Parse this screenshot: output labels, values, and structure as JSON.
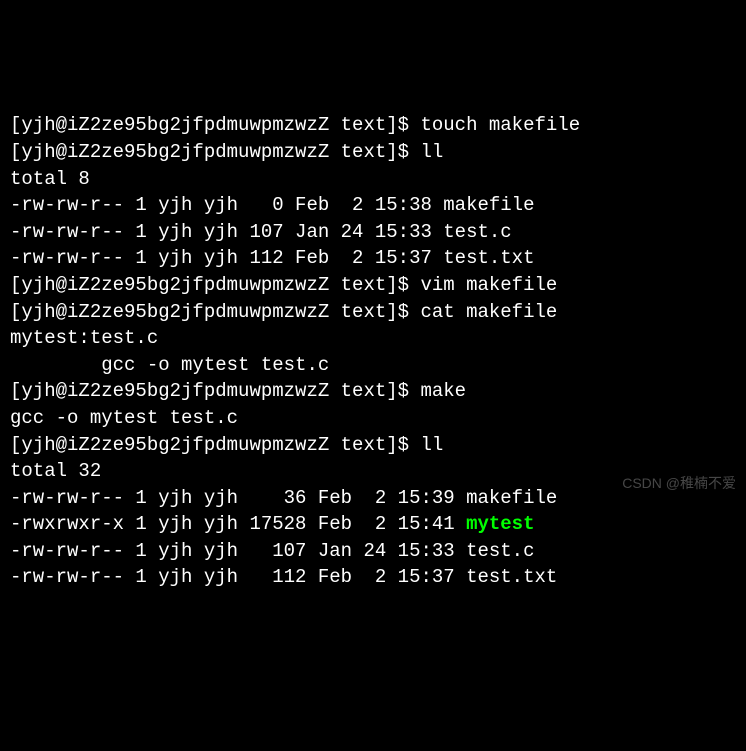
{
  "prompt": "[yjh@iZ2ze95bg2jfpdmuwpmzwzZ text]$ ",
  "lines": [
    {
      "prompt": true,
      "cmd": "touch makefile"
    },
    {
      "prompt": true,
      "cmd": "ll"
    },
    {
      "text": "total 8"
    },
    {
      "text": "-rw-rw-r-- 1 yjh yjh   0 Feb  2 15:38 makefile"
    },
    {
      "text": "-rw-rw-r-- 1 yjh yjh 107 Jan 24 15:33 test.c"
    },
    {
      "text": "-rw-rw-r-- 1 yjh yjh 112 Feb  2 15:37 test.txt"
    },
    {
      "prompt": true,
      "cmd": "vim makefile"
    },
    {
      "prompt": true,
      "cmd": "cat makefile"
    },
    {
      "text": "mytest:test.c"
    },
    {
      "text": "        gcc -o mytest test.c"
    },
    {
      "prompt": true,
      "cmd": "make"
    },
    {
      "text": "gcc -o mytest test.c"
    },
    {
      "prompt": true,
      "cmd": "ll"
    },
    {
      "text": "total 32"
    },
    {
      "text": "-rw-rw-r-- 1 yjh yjh    36 Feb  2 15:39 makefile"
    },
    {
      "text": "-rwxrwxr-x 1 yjh yjh 17528 Feb  2 15:41 ",
      "exec": "mytest"
    },
    {
      "text": "-rw-rw-r-- 1 yjh yjh   107 Jan 24 15:33 test.c"
    },
    {
      "text": "-rw-rw-r-- 1 yjh yjh   112 Feb  2 15:37 test.txt"
    }
  ],
  "watermark": "CSDN @稚楠不爱"
}
